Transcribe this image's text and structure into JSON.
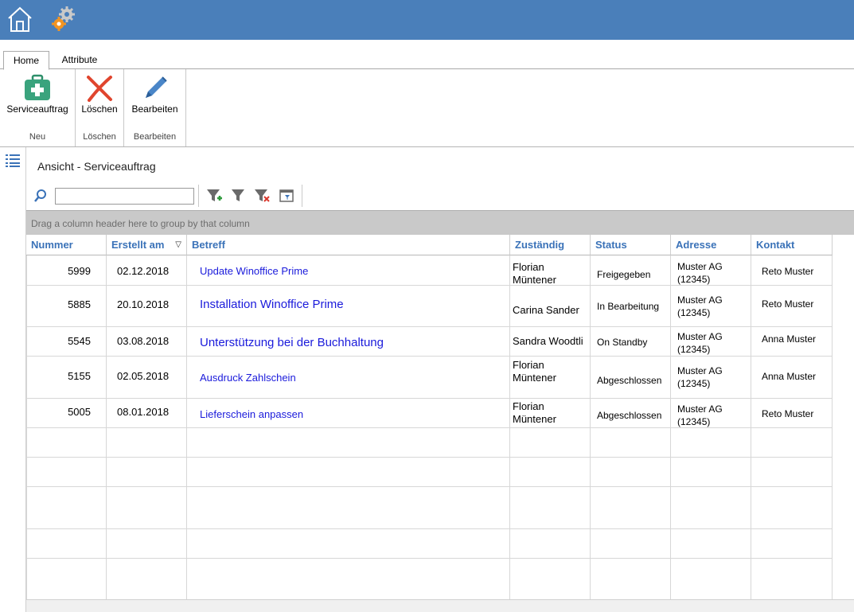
{
  "ribbon": {
    "tabs": [
      {
        "label": "Home",
        "active": true
      },
      {
        "label": "Attribute",
        "active": false
      }
    ],
    "groups": [
      {
        "button_label": "Serviceauftrag",
        "group_label": "Neu",
        "icon": "medical-case-icon"
      },
      {
        "button_label": "Löschen",
        "group_label": "Löschen",
        "icon": "delete-x-icon"
      },
      {
        "button_label": "Bearbeiten",
        "group_label": "Bearbeiten",
        "icon": "pencil-icon"
      }
    ]
  },
  "view": {
    "title": "Ansicht - Serviceauftrag",
    "search_value": "",
    "group_panel_hint": "Drag a column header here to group by that column"
  },
  "grid": {
    "columns": [
      {
        "label": "Nummer"
      },
      {
        "label": "Erstellt am",
        "sorted": "desc"
      },
      {
        "label": "Betreff"
      },
      {
        "label": "Zuständig"
      },
      {
        "label": "Status"
      },
      {
        "label": "Adresse"
      },
      {
        "label": "Kontakt"
      }
    ],
    "rows": [
      {
        "nummer": "5999",
        "erstellt": "02.12.2018",
        "betreff": "Update Winoffice Prime",
        "zustaendig": "Florian Müntener",
        "status": "Freigegeben",
        "adresse": "Muster AG (12345)",
        "kontakt": "Reto Muster"
      },
      {
        "nummer": "5885",
        "erstellt": "20.10.2018",
        "betreff": "Installation Winoffice Prime",
        "zustaendig": "Carina Sander",
        "status": "In Bearbeitung",
        "adresse": "Muster AG (12345)",
        "kontakt": "Reto Muster"
      },
      {
        "nummer": "5545",
        "erstellt": "03.08.2018",
        "betreff": "Unterstützung bei der Buchhaltung",
        "zustaendig": "Sandra Woodtli",
        "status": "On Standby",
        "adresse": "Muster AG (12345)",
        "kontakt": "Anna Muster"
      },
      {
        "nummer": "5155",
        "erstellt": "02.05.2018",
        "betreff": "Ausdruck Zahlschein",
        "zustaendig": "Florian Müntener",
        "status": "Abgeschlossen",
        "adresse": "Muster AG (12345)",
        "kontakt": "Anna Muster"
      },
      {
        "nummer": "5005",
        "erstellt": "08.01.2018",
        "betreff": "Lieferschein anpassen",
        "zustaendig": "Florian Müntener",
        "status": "Abgeschlossen",
        "adresse": "Muster AG (12345)",
        "kontakt": "Reto Muster"
      }
    ]
  },
  "colors": {
    "titlebar": "#4a7fba",
    "header_text": "#3a72b8",
    "link": "#1a1adb",
    "group_panel": "#c9c9c9"
  }
}
